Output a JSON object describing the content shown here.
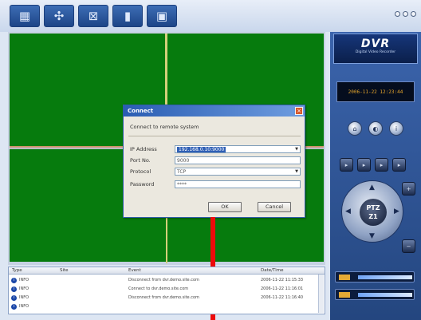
{
  "toolbar": {
    "icons": [
      "camera-grid-icon",
      "network-tools-icon",
      "layout-icon",
      "record-icon",
      "calendar-icon"
    ]
  },
  "dialog": {
    "title": "Connect",
    "description": "Connect to remote system",
    "fields": [
      {
        "label": "IP Address",
        "value": "192.168.0.10:9000",
        "type": "select"
      },
      {
        "label": "Port No.",
        "value": "9000",
        "type": "text"
      },
      {
        "label": "Protocol",
        "value": "TCP",
        "type": "select"
      },
      {
        "label": "Password",
        "value": "****",
        "type": "password"
      }
    ],
    "ok_label": "OK",
    "cancel_label": "Cancel"
  },
  "log": {
    "columns": [
      "Type",
      "Site",
      "Event",
      "Date/Time"
    ],
    "rows": [
      {
        "type": "INFO",
        "site": "",
        "event": "Disconnect from dvr.demo.site.com",
        "datetime": "2006-11-22 11:15:33"
      },
      {
        "type": "INFO",
        "site": "",
        "event": "Connect to dvr.demo.site.com",
        "datetime": "2006-11-22 11:16:01"
      },
      {
        "type": "INFO",
        "site": "",
        "event": "Disconnect from dvr.demo.site.com",
        "datetime": "2006-11-22 11:16:40"
      },
      {
        "type": "INFO",
        "site": "",
        "event": "",
        "datetime": ""
      }
    ]
  },
  "panel": {
    "logo_title": "DVR",
    "logo_subtitle": "Digital Video Recorder",
    "clock": "2006-11-22  12:23:44",
    "ptz_label": "PTZ",
    "ptz_sub": "Z1"
  },
  "colors": {
    "video_bg": "#067b0d",
    "accent": "#2a5db3",
    "marker": "#ee0b0b"
  }
}
